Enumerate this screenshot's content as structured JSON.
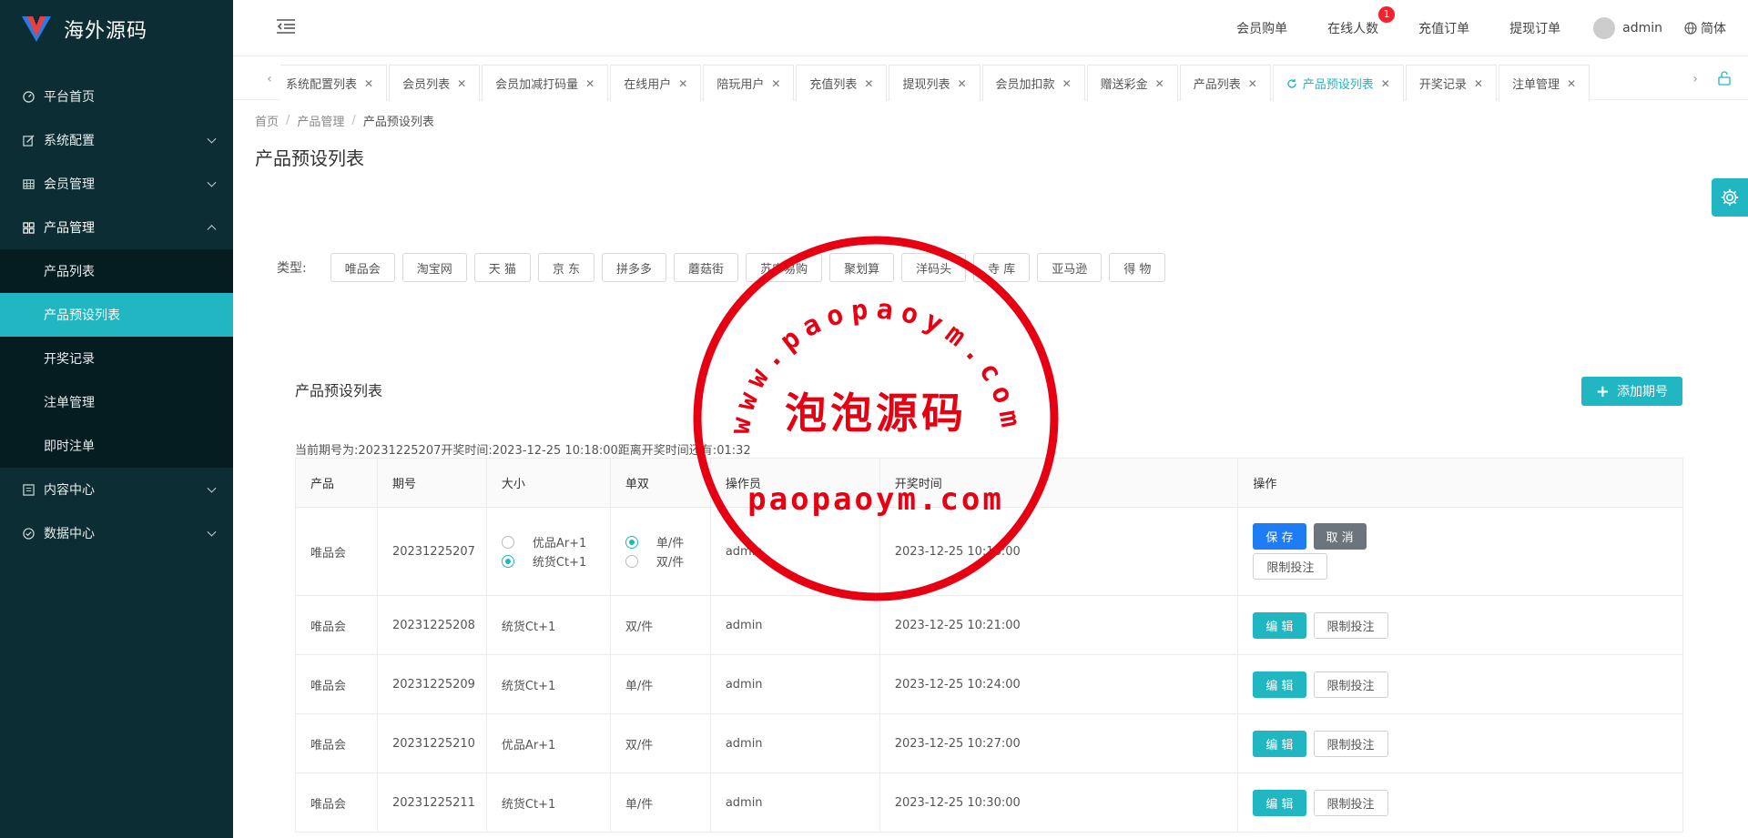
{
  "app": {
    "title": "海外源码"
  },
  "sidebar": {
    "items": [
      {
        "label": "平台首页",
        "icon": "dashboard-icon"
      },
      {
        "label": "系统配置",
        "icon": "edit-icon"
      },
      {
        "label": "会员管理",
        "icon": "table-icon"
      },
      {
        "label": "产品管理",
        "icon": "grid-icon"
      },
      {
        "label": "内容中心",
        "icon": "doc-icon"
      },
      {
        "label": "数据中心",
        "icon": "check-circle-icon"
      }
    ],
    "sub_items": [
      "产品列表",
      "产品预设列表",
      "开奖记录",
      "注单管理",
      "即时注单"
    ]
  },
  "header": {
    "links": [
      "会员购单",
      "在线人数",
      "充值订单",
      "提现订单"
    ],
    "online_badge": "1",
    "user": "admin",
    "lang": "简体"
  },
  "tabs": [
    "系统配置列表",
    "会员列表",
    "会员加减打码量",
    "在线用户",
    "陪玩用户",
    "充值列表",
    "提现列表",
    "会员加扣款",
    "赠送彩金",
    "产品列表",
    "产品预设列表",
    "开奖记录",
    "注单管理"
  ],
  "active_tab": "产品预设列表",
  "breadcrumb": [
    "首页",
    "产品管理",
    "产品预设列表"
  ],
  "page_title": "产品预设列表",
  "type_filter": {
    "label": "类型:",
    "options": [
      "唯品会",
      "淘宝网",
      "天 猫",
      "京 东",
      "拼多多",
      "蘑菇街",
      "苏宁易购",
      "聚划算",
      "洋码头",
      "寺 库",
      "亚马逊",
      "得 物"
    ]
  },
  "panel": {
    "title": "产品预设列表",
    "add_button": "添加期号",
    "period_info": "当前期号为:20231225207开奖时间:2023-12-25 10:18:00距离开奖时间还有:01:32"
  },
  "table": {
    "headers": [
      "产品",
      "期号",
      "大小",
      "单双",
      "操作员",
      "开奖时间",
      "操作"
    ],
    "edit_row": {
      "product": "唯品会",
      "period": "20231225207",
      "size_options": [
        "优品Ar+1",
        "统货Ct+1"
      ],
      "size_selected": "统货Ct+1",
      "parity_options": [
        "单/件",
        "双/件"
      ],
      "parity_selected": "单/件",
      "operator": "admin",
      "time": "2023-12-25 10:18:00",
      "save": "保 存",
      "cancel": "取 消",
      "limit": "限制投注"
    },
    "rows": [
      {
        "product": "唯品会",
        "period": "20231225208",
        "size": "统货Ct+1",
        "parity": "双/件",
        "operator": "admin",
        "time": "2023-12-25 10:21:00"
      },
      {
        "product": "唯品会",
        "period": "20231225209",
        "size": "统货Ct+1",
        "parity": "单/件",
        "operator": "admin",
        "time": "2023-12-25 10:24:00"
      },
      {
        "product": "唯品会",
        "period": "20231225210",
        "size": "优品Ar+1",
        "parity": "双/件",
        "operator": "admin",
        "time": "2023-12-25 10:27:00"
      },
      {
        "product": "唯品会",
        "period": "20231225211",
        "size": "统货Ct+1",
        "parity": "单/件",
        "operator": "admin",
        "time": "2023-12-25 10:30:00"
      }
    ],
    "edit_label": "编 辑",
    "limit_label": "限制投注"
  },
  "watermark": {
    "url_text": "www.paopaoym.com",
    "center_text": "泡泡源码",
    "bottom_text": "paopaoym.com",
    "color": "#e60012"
  },
  "colors": {
    "accent": "#20b6c2",
    "sidebar_bg": "#0b2d33",
    "save_btn": "#1e7cf5",
    "badge": "#f5222d"
  }
}
